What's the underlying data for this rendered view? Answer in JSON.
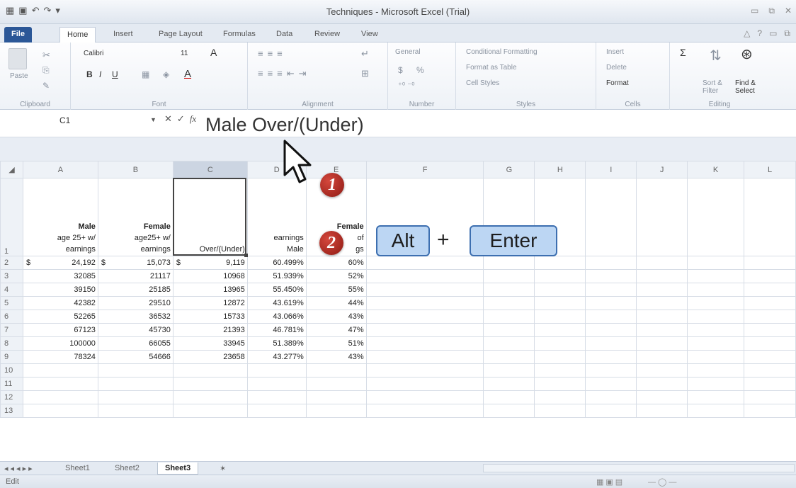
{
  "window": {
    "title": "Techniques  -  Microsoft Excel (Trial)"
  },
  "ribbon_tabs": [
    "File",
    "Home",
    "Insert",
    "Page Layout",
    "Formulas",
    "Data",
    "Review",
    "View"
  ],
  "ribbon": {
    "clipboard": {
      "paste": "Paste",
      "label": "Clipboard"
    },
    "font": {
      "name": "Calibri",
      "size": "11",
      "bold": "B",
      "italic": "I",
      "underline": "U",
      "grow": "A",
      "label": "Font"
    },
    "alignment": {
      "label": "Alignment"
    },
    "number": {
      "format": "General",
      "currency": "$",
      "percent": "%",
      "label": "Number"
    },
    "styles": {
      "conditional": "Conditional Formatting",
      "table": "Format as Table",
      "cell": "Cell Styles",
      "label": "Styles"
    },
    "cells": {
      "insert": "Insert",
      "delete": "Delete",
      "format": "Format",
      "label": "Cells"
    },
    "editing": {
      "sum": "Σ",
      "sort": "Sort & Filter",
      "find": "Find & Select",
      "label": "Editing"
    }
  },
  "formula_bar": {
    "name_box": "C1",
    "formula": "Male  Over/(Under)"
  },
  "columns": [
    "A",
    "B",
    "C",
    "D",
    "E",
    "F",
    "G",
    "H",
    "I",
    "J",
    "K",
    "L"
  ],
  "header_row": {
    "row": "1",
    "a": [
      "Male",
      "age 25+ w/",
      "earnings"
    ],
    "b": [
      "Female",
      "age25+ w/",
      "earnings"
    ],
    "c": "Over/(Under)",
    "d": [
      "earnings",
      "Male"
    ],
    "e": [
      "Female",
      "of",
      "gs"
    ]
  },
  "rows": [
    {
      "n": "2",
      "a": "24,192",
      "a_sym": "$",
      "b": "15,073",
      "b_sym": "$",
      "c": "9,119",
      "c_sym": "$",
      "d": "60.499%",
      "e": "60%"
    },
    {
      "n": "3",
      "a": "32085",
      "b": "21117",
      "c": "10968",
      "d": "51.939%",
      "e": "52%"
    },
    {
      "n": "4",
      "a": "39150",
      "b": "25185",
      "c": "13965",
      "d": "55.450%",
      "e": "55%"
    },
    {
      "n": "5",
      "a": "42382",
      "b": "29510",
      "c": "12872",
      "d": "43.619%",
      "e": "44%"
    },
    {
      "n": "6",
      "a": "52265",
      "b": "36532",
      "c": "15733",
      "d": "43.066%",
      "e": "43%"
    },
    {
      "n": "7",
      "a": "67123",
      "b": "45730",
      "c": "21393",
      "d": "46.781%",
      "e": "47%"
    },
    {
      "n": "8",
      "a": "100000",
      "b": "66055",
      "c": "33945",
      "d": "51.389%",
      "e": "51%"
    },
    {
      "n": "9",
      "a": "78324",
      "b": "54666",
      "c": "23658",
      "d": "43.277%",
      "e": "43%"
    }
  ],
  "empty_rows": [
    "10",
    "11",
    "12",
    "13"
  ],
  "overlay": {
    "step1": "1",
    "step2": "2",
    "key_alt": "Alt",
    "plus": "+",
    "key_enter": "Enter"
  },
  "sheet_tabs": [
    "Sheet1",
    "Sheet2",
    "Sheet3"
  ],
  "status": {
    "mode": "Edit"
  }
}
